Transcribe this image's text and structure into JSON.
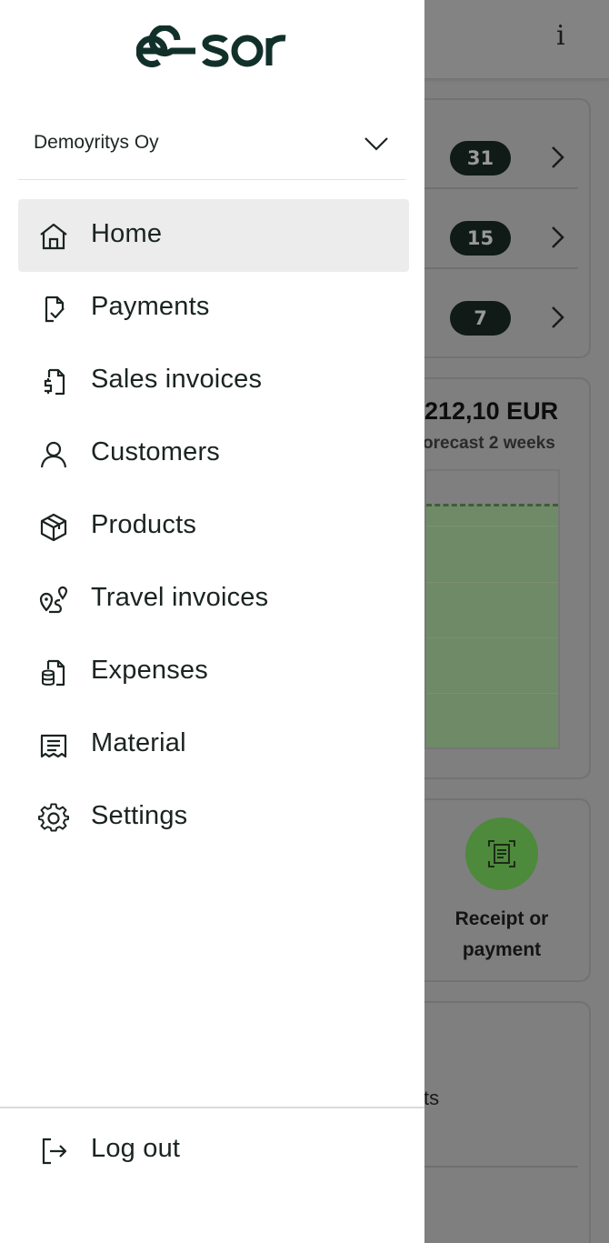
{
  "brand": {
    "logo_text": "easor"
  },
  "company_selector": {
    "value": "Demoyritys Oy",
    "icon": "chevron-down-icon"
  },
  "menu": {
    "items": [
      {
        "label": "Home",
        "icon": "home-icon",
        "active": true
      },
      {
        "label": "Payments",
        "icon": "payment-check-icon",
        "active": false
      },
      {
        "label": "Sales invoices",
        "icon": "invoice-dollar-icon",
        "active": false
      },
      {
        "label": "Customers",
        "icon": "person-icon",
        "active": false
      },
      {
        "label": "Products",
        "icon": "box-icon",
        "active": false
      },
      {
        "label": "Travel invoices",
        "icon": "route-icon",
        "active": false
      },
      {
        "label": "Expenses",
        "icon": "expense-doc-icon",
        "active": false
      },
      {
        "label": "Material",
        "icon": "receipt-icon",
        "active": false
      },
      {
        "label": "Settings",
        "icon": "gear-icon",
        "active": false
      }
    ],
    "logout": {
      "label": "Log out",
      "icon": "logout-icon"
    }
  },
  "background": {
    "info_label": "i",
    "badges": [
      "31",
      "15",
      "7"
    ],
    "amount": "212,10 EUR",
    "forecast": "orecast 2 weeks",
    "receipt_button": "Receipt or payment",
    "partial_text": "ts"
  },
  "colors": {
    "drawer_bg": "#ffffff",
    "active_bg": "#ececec",
    "text": "#1a2421",
    "overlay": "#7f7f7f",
    "fab": "#4d8a3b",
    "badge": "#101a17"
  }
}
